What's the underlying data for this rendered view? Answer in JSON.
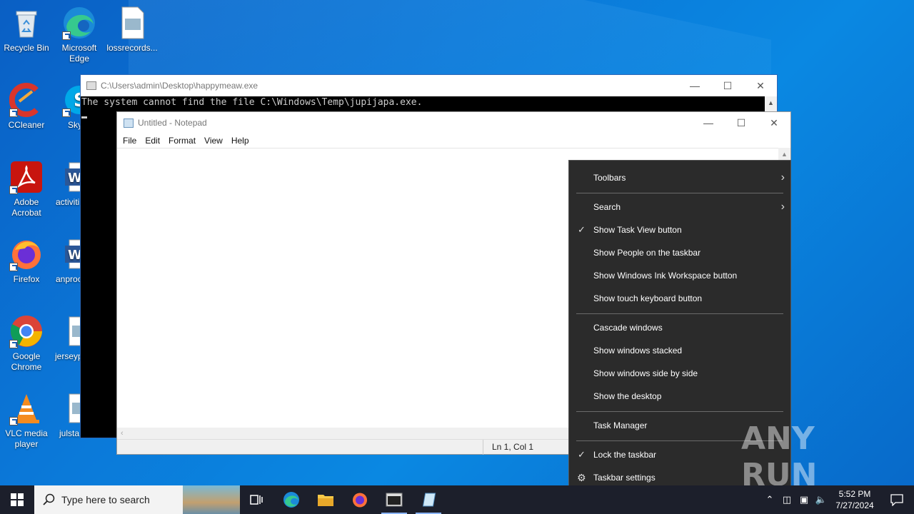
{
  "desktop": {
    "icons": [
      {
        "label": "Recycle Bin"
      },
      {
        "label": "Microsoft Edge"
      },
      {
        "label": "lossrecords..."
      },
      {
        "label": "CCleaner"
      },
      {
        "label": "Sky"
      },
      {
        "label": "Adobe Acrobat"
      },
      {
        "label": "activiti"
      },
      {
        "label": "Firefox"
      },
      {
        "label": "anproc"
      },
      {
        "label": "Google Chrome"
      },
      {
        "label": "jerseyp"
      },
      {
        "label": "VLC media player"
      },
      {
        "label": "julsta"
      }
    ]
  },
  "console": {
    "title": "C:\\Users\\admin\\Desktop\\happymeaw.exe",
    "output": "The system cannot find the file C:\\Windows\\Temp\\jupijapa.exe."
  },
  "notepad": {
    "title": "Untitled - Notepad",
    "menu": [
      "File",
      "Edit",
      "Format",
      "View",
      "Help"
    ],
    "status_position": "Ln 1, Col 1"
  },
  "context_menu": {
    "items": [
      {
        "label": "Toolbars",
        "submenu": true,
        "checked": false
      },
      {
        "label": "Search",
        "submenu": true,
        "checked": false
      },
      {
        "label": "Show Task View button",
        "checked": true
      },
      {
        "label": "Show People on the taskbar",
        "checked": false
      },
      {
        "label": "Show Windows Ink Workspace button",
        "checked": false
      },
      {
        "label": "Show touch keyboard button",
        "checked": false
      },
      {
        "label": "Cascade windows"
      },
      {
        "label": "Show windows stacked"
      },
      {
        "label": "Show windows side by side"
      },
      {
        "label": "Show the desktop"
      },
      {
        "label": "Task Manager"
      },
      {
        "label": "Lock the taskbar",
        "checked": true
      },
      {
        "label": "Taskbar settings"
      }
    ]
  },
  "watermark": {
    "text": "ANY RUN"
  },
  "taskbar": {
    "search_placeholder": "Type here to search",
    "clock_time": "5:52 PM",
    "clock_date": "7/27/2024"
  },
  "colors": {
    "desktop": "#0b78d8",
    "taskbar": "#1c1f2b",
    "context_menu_bg": "#2b2b2b"
  }
}
